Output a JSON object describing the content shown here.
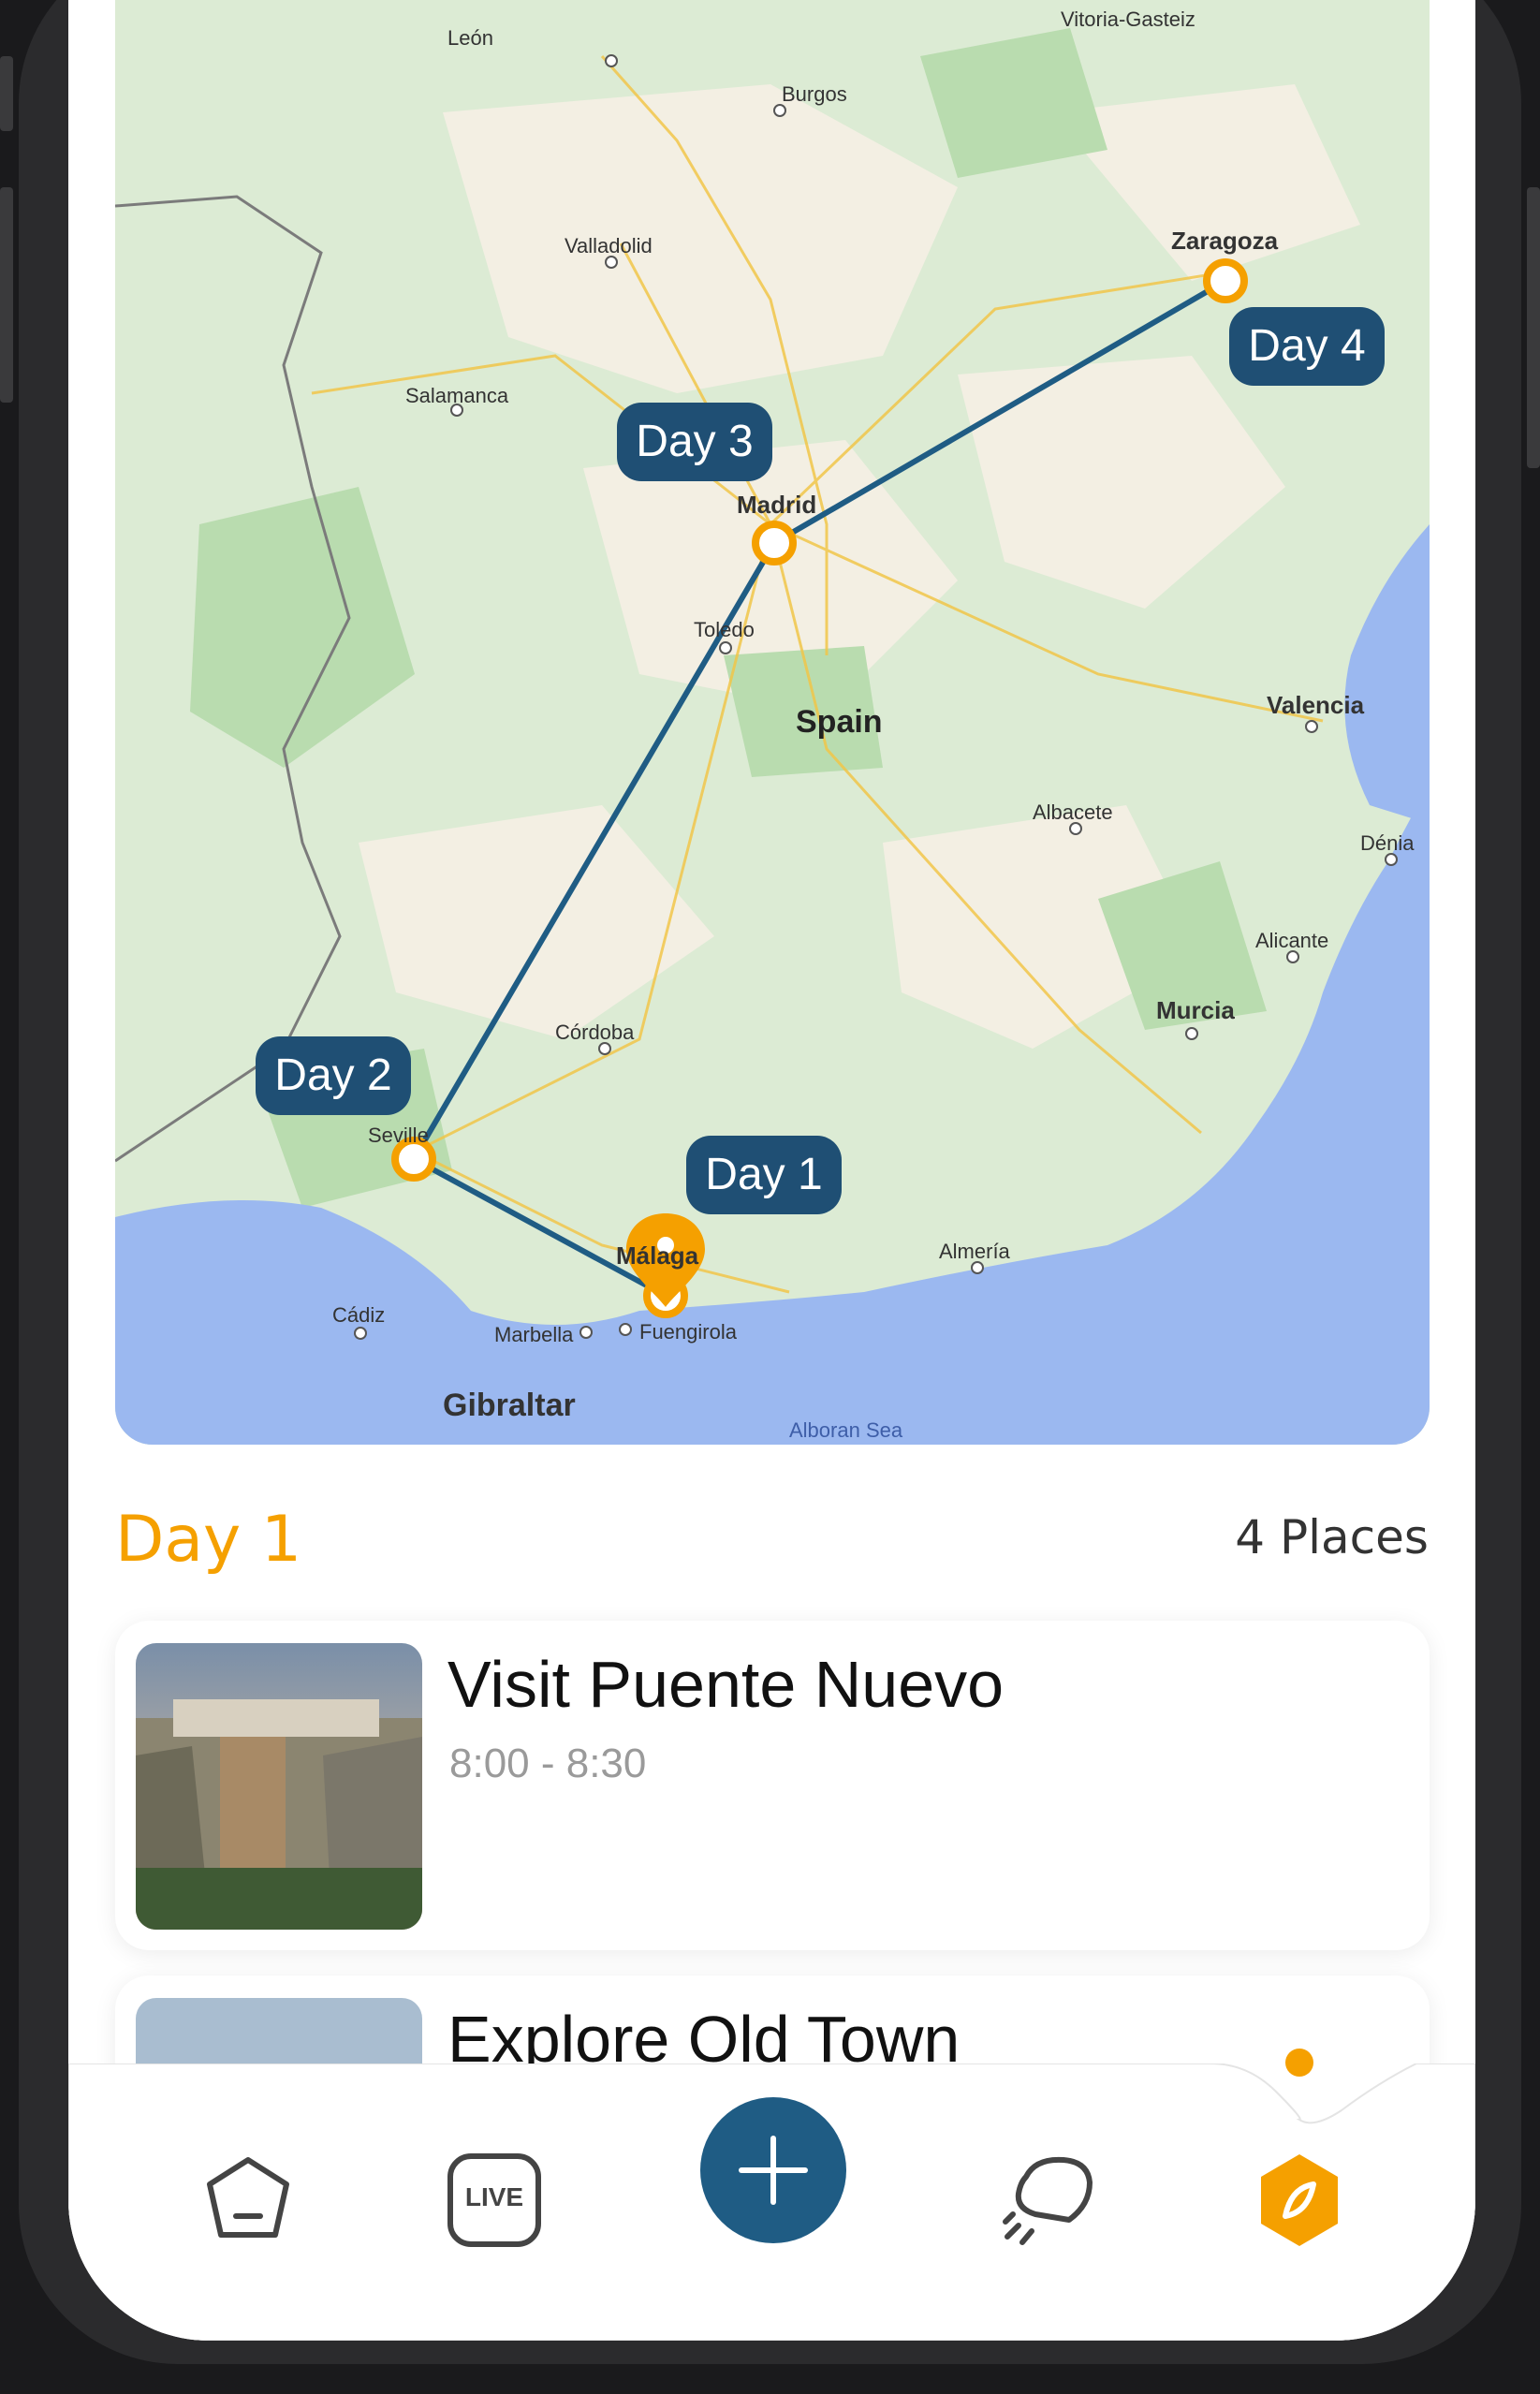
{
  "map": {
    "country_label": "Spain",
    "cities": [
      "León",
      "Vitoria-Gasteiz",
      "Burgos",
      "Valladolid",
      "Zaragoza",
      "Salamanca",
      "Madrid",
      "Toledo",
      "Valencia",
      "Albacete",
      "Dénia",
      "Alicante",
      "Murcia",
      "Córdoba",
      "Seville",
      "Málaga",
      "Almería",
      "Cádiz",
      "Marbella",
      "Fuengirola",
      "Gibraltar",
      "Alboran Sea"
    ],
    "day_pills": [
      "Day 1",
      "Day 2",
      "Day 3",
      "Day 4"
    ],
    "route_color": "#1F5C84",
    "marker_color": "#F5A000"
  },
  "day_section": {
    "title": "Day 1",
    "places_count": "4 Places"
  },
  "places": [
    {
      "title": "Visit Puente Nuevo",
      "time": "8:00 - 8:30"
    },
    {
      "title": "Explore Old Town",
      "time": ""
    }
  ],
  "nav": {
    "live_label": "LIVE",
    "fab_icon": "plus-icon",
    "accent": "#F5A000",
    "fab_color": "#1F5C84"
  }
}
